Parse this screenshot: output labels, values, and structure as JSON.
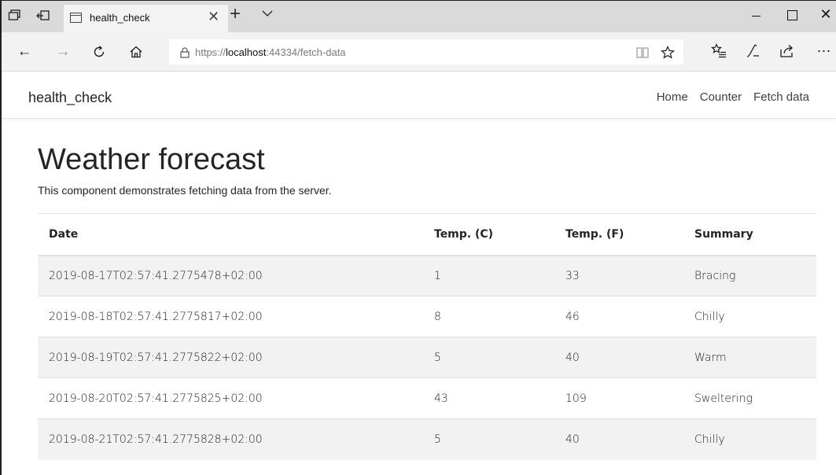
{
  "browser": {
    "tab_title": "health_check",
    "address": {
      "scheme": "https://",
      "host": "localhost",
      "rest": ":44334/fetch-data"
    }
  },
  "app": {
    "brand": "health_check",
    "nav": [
      "Home",
      "Counter",
      "Fetch data"
    ]
  },
  "page": {
    "title": "Weather forecast",
    "description": "This component demonstrates fetching data from the server."
  },
  "table": {
    "headers": [
      "Date",
      "Temp. (C)",
      "Temp. (F)",
      "Summary"
    ],
    "rows": [
      [
        "2019-08-17T02:57:41.2775478+02:00",
        "1",
        "33",
        "Bracing"
      ],
      [
        "2019-08-18T02:57:41.2775817+02:00",
        "8",
        "46",
        "Chilly"
      ],
      [
        "2019-08-19T02:57:41.2775822+02:00",
        "5",
        "40",
        "Warm"
      ],
      [
        "2019-08-20T02:57:41.2775825+02:00",
        "43",
        "109",
        "Sweltering"
      ],
      [
        "2019-08-21T02:57:41.2775828+02:00",
        "5",
        "40",
        "Chilly"
      ]
    ]
  },
  "icons": {
    "tab_preview": "tabs-preview-icon",
    "set_aside": "set-aside-tabs-icon",
    "back": "back-arrow-icon",
    "forward": "forward-arrow-icon",
    "refresh": "refresh-icon",
    "home": "home-icon",
    "lock": "lock-icon",
    "reading_view": "reading-view-icon",
    "favorite": "star-icon",
    "favorites": "favorites-list-icon",
    "notes": "pen-icon",
    "share": "share-icon",
    "more": "more-icon"
  }
}
